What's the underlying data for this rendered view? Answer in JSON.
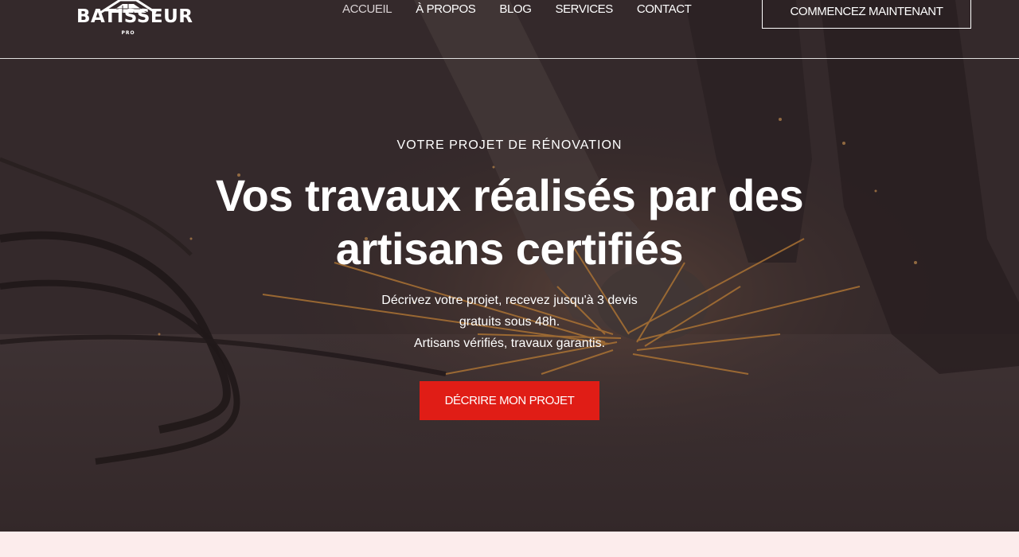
{
  "brand": {
    "name": "BATISSEUR",
    "sub": "PRO",
    "accent_color": "#e01d16"
  },
  "nav": {
    "items": [
      {
        "label": "ACCUEIL",
        "active": true
      },
      {
        "label": "À PROPOS",
        "active": false
      },
      {
        "label": "BLOG",
        "active": false
      },
      {
        "label": "SERVICES",
        "active": false
      },
      {
        "label": "CONTACT",
        "active": false
      }
    ],
    "cta_label": "COMMENCEZ MAINTENANT"
  },
  "hero": {
    "eyebrow": "VOTRE PROJET DE RÉNOVATION",
    "headline": "Vos travaux réalisés par des artisans certifiés",
    "description_lines": [
      "Décrivez votre projet, recevez jusqu'à 3 devis",
      "gratuits sous 48h.",
      "Artisans vérifiés, travaux garantis."
    ],
    "cta_label": "DÉCRIRE MON PROJET"
  }
}
